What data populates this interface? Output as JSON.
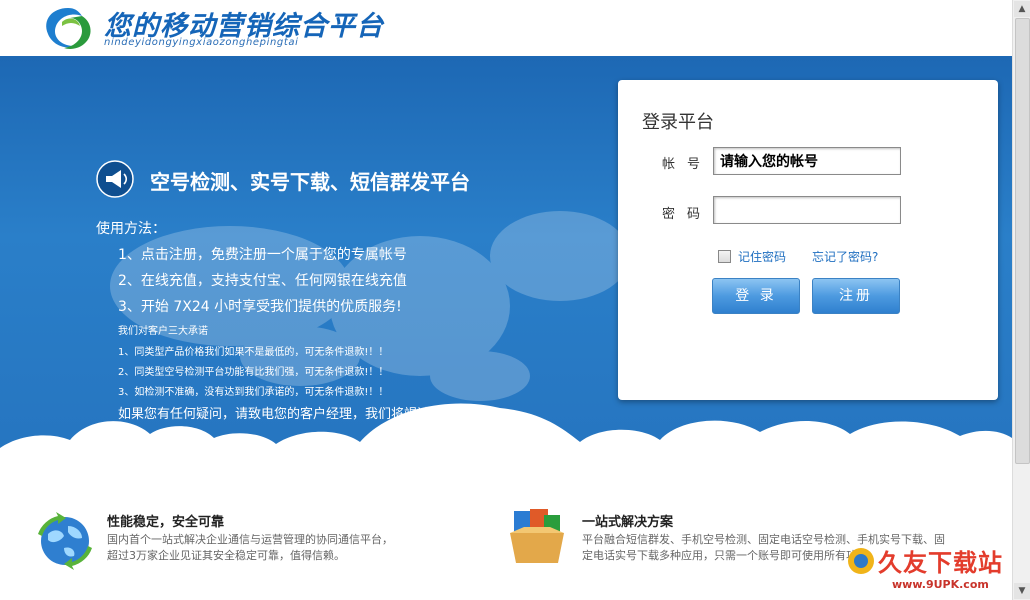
{
  "brand": {
    "title": "您的移动营销综合平台",
    "subtitle": "nindeyidongyingxiaozonghepingtai"
  },
  "hero": {
    "slogan": "空号检测、实号下载、短信群发平台",
    "usage_title": "使用方法：",
    "steps": [
      "1、点击注册，免费注册一个属于您的专属帐号",
      "2、在线充值，支持支付宝、任何网银在线充值",
      "3、开始 7X24 小时享受我们提供的优质服务!"
    ],
    "promise_title": "我们对客户三大承诺",
    "promises": [
      "1、同类型产品价格我们如果不是最低的，可无条件退款!！！",
      "2、同类型空号检测平台功能有比我们强，可无条件退款!！！",
      "3、如检测不准确，没有达到我们承诺的，可无条件退款!！！"
    ],
    "closing": "如果您有任何疑问，请致电您的客户经理，我们将竭诚为您服务。"
  },
  "login": {
    "title": "登录平台",
    "account_label": "帐号",
    "account_value": "请输入您的帐号",
    "password_label": "密码",
    "remember_label": "记住密码",
    "forgot_label": "忘记了密码?",
    "login_button": "登 录",
    "register_button": "注册"
  },
  "features": [
    {
      "title": "性能稳定，安全可靠",
      "desc_line1": "国内首个一站式解决企业通信与运营管理的协同通信平台，",
      "desc_line2": "超过3万家企业见证其安全稳定可靠，值得信赖。"
    },
    {
      "title": "一站式解决方案",
      "desc_line1": "平台融合短信群发、手机空号检测、固定电话空号检测、手机实号下载、固",
      "desc_line2": "定电话实号下载多种应用，只需一个账号即可使用所有功能"
    }
  ],
  "watermark": {
    "text": "久友下载站",
    "url": "www.9UPK.com"
  },
  "colors": {
    "hero_blue": "#2675c0",
    "brand_blue": "#1565b8",
    "link_blue": "#1f6fc0",
    "button_blue": "#4d9ae0"
  }
}
